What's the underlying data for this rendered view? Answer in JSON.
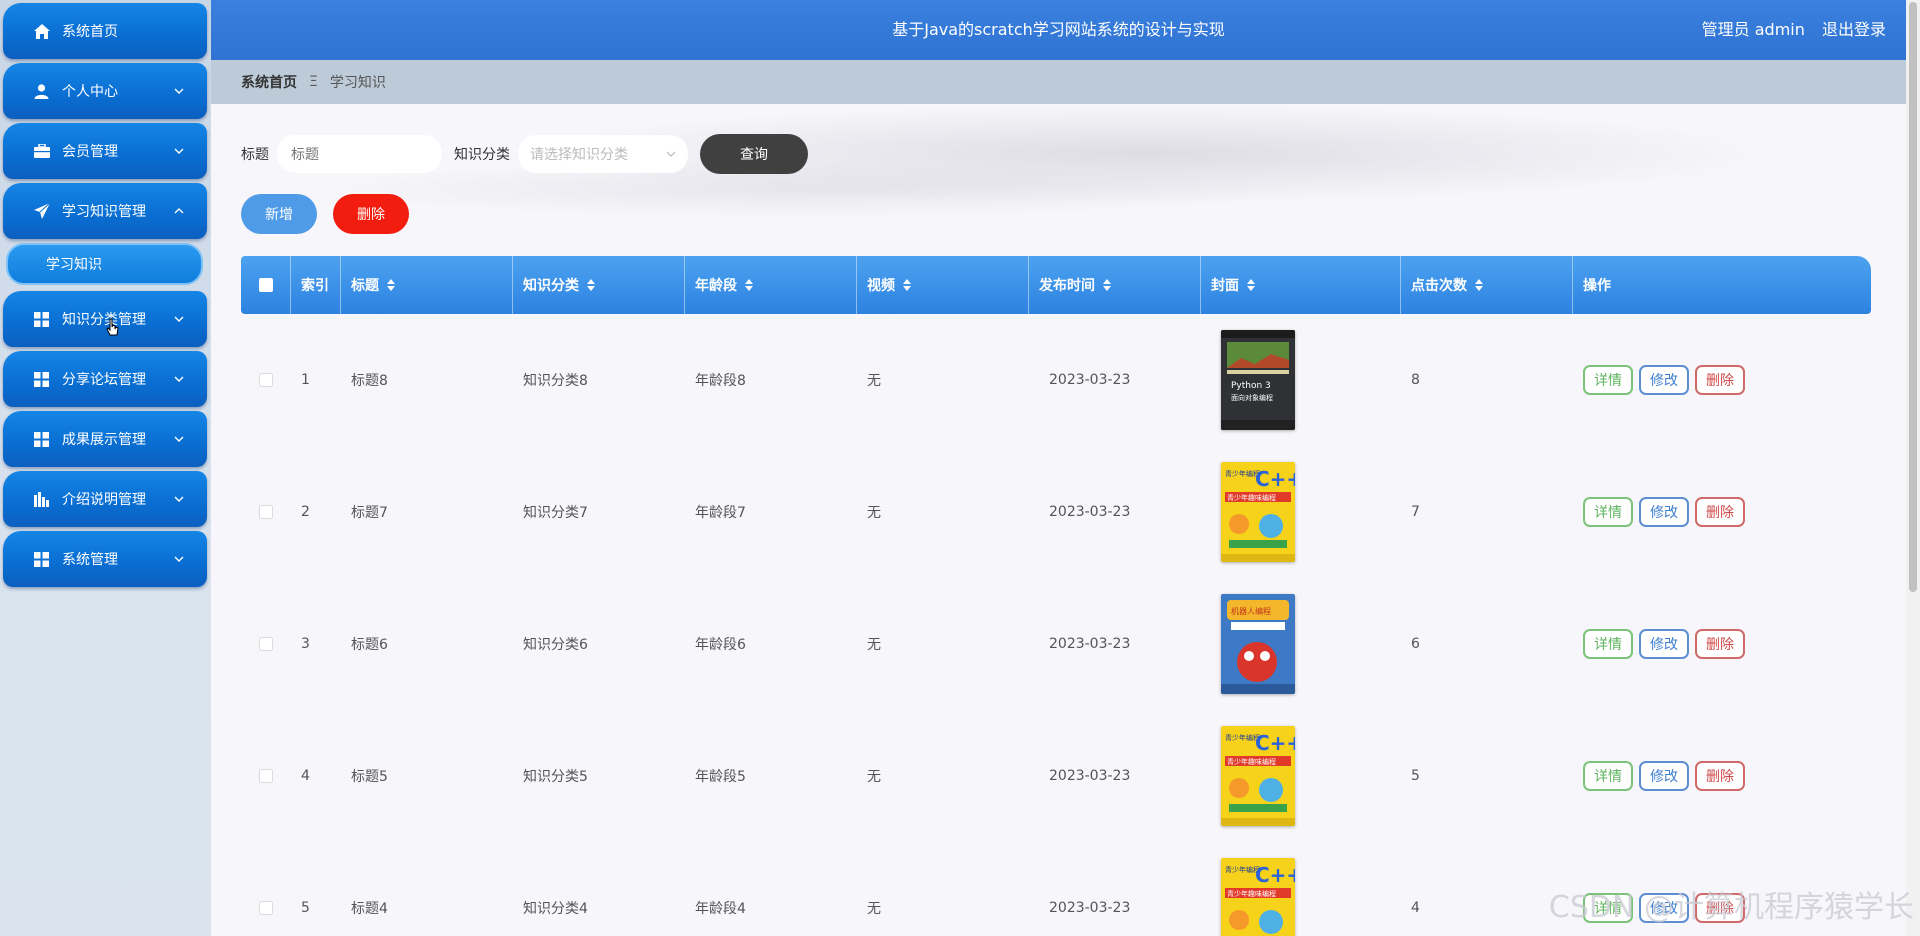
{
  "header": {
    "title": "基于Java的scratch学习网站系统的设计与实现",
    "user_label": "管理员 admin",
    "logout_label": "退出登录"
  },
  "sidebar": {
    "items": [
      {
        "label": "系统首页",
        "icon": "home-icon"
      },
      {
        "label": "个人中心",
        "icon": "user-icon"
      },
      {
        "label": "会员管理",
        "icon": "briefcase-icon"
      },
      {
        "label": "学习知识管理",
        "icon": "send-icon",
        "expanded": true
      },
      {
        "label": "知识分类管理",
        "icon": "grid-icon"
      },
      {
        "label": "分享论坛管理",
        "icon": "grid-icon"
      },
      {
        "label": "成果展示管理",
        "icon": "grid-icon"
      },
      {
        "label": "介绍说明管理",
        "icon": "bar-chart-icon"
      },
      {
        "label": "系统管理",
        "icon": "grid-icon"
      }
    ],
    "submenu": {
      "label": "学习知识"
    }
  },
  "breadcrumb": {
    "home": "系统首页",
    "separator": "Ξ",
    "current": "学习知识"
  },
  "search": {
    "title_label": "标题",
    "title_placeholder": "标题",
    "category_label": "知识分类",
    "category_placeholder": "请选择知识分类",
    "query_label": "查询"
  },
  "actions": {
    "add_label": "新增",
    "delete_label": "删除"
  },
  "table": {
    "columns": [
      "索引",
      "标题",
      "知识分类",
      "年龄段",
      "视频",
      "发布时间",
      "封面",
      "点击次数",
      "操作"
    ],
    "rows": [
      {
        "index": "1",
        "title": "标题8",
        "category": "知识分类8",
        "age": "年龄段8",
        "video": "无",
        "date": "2023-03-23",
        "cover": "python-book",
        "clicks": "8"
      },
      {
        "index": "2",
        "title": "标题7",
        "category": "知识分类7",
        "age": "年龄段7",
        "video": "无",
        "date": "2023-03-23",
        "cover": "cpp-book",
        "clicks": "7"
      },
      {
        "index": "3",
        "title": "标题6",
        "category": "知识分类6",
        "age": "年龄段6",
        "video": "无",
        "date": "2023-03-23",
        "cover": "robot-book",
        "clicks": "6"
      },
      {
        "index": "4",
        "title": "标题5",
        "category": "知识分类5",
        "age": "年龄段5",
        "video": "无",
        "date": "2023-03-23",
        "cover": "cpp-book",
        "clicks": "5"
      },
      {
        "index": "5",
        "title": "标题4",
        "category": "知识分类4",
        "age": "年龄段4",
        "video": "无",
        "date": "2023-03-23",
        "cover": "cpp-book",
        "clicks": "4"
      }
    ],
    "op_labels": {
      "detail": "详情",
      "edit": "修改",
      "delete": "删除"
    }
  },
  "watermark": "CSDN @计算机程序猿学长",
  "colors": {
    "header_bg": "#3a80dd",
    "sidebar_item": "#0a6fd3",
    "table_header": "#3d92ea",
    "delete_button": "#f21d0e",
    "query_button": "#404040"
  }
}
